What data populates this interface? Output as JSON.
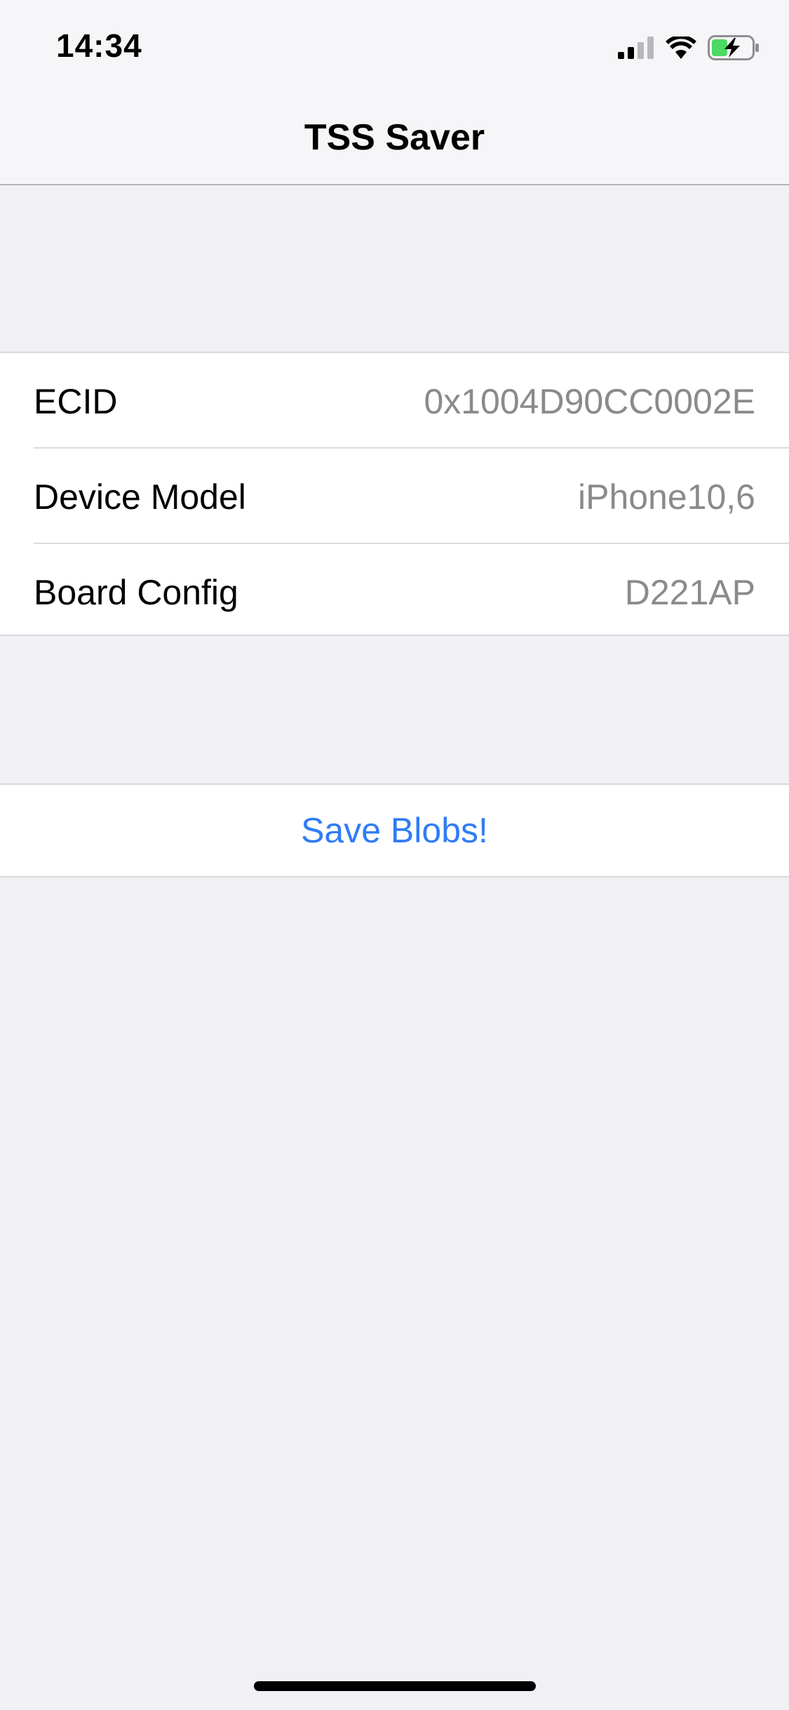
{
  "status_bar": {
    "time": "14:34",
    "icons": [
      "cellular-signal-icon",
      "wifi-icon",
      "battery-charging-icon"
    ],
    "battery_color": "#4cd964"
  },
  "nav": {
    "title": "TSS Saver"
  },
  "info_rows": [
    {
      "label": "ECID",
      "value": "0x1004D90CC0002E"
    },
    {
      "label": "Device Model",
      "value": "iPhone10,6"
    },
    {
      "label": "Board Config",
      "value": "D221AP"
    }
  ],
  "action": {
    "label": "Save Blobs!",
    "color": "#2f7cf6"
  }
}
